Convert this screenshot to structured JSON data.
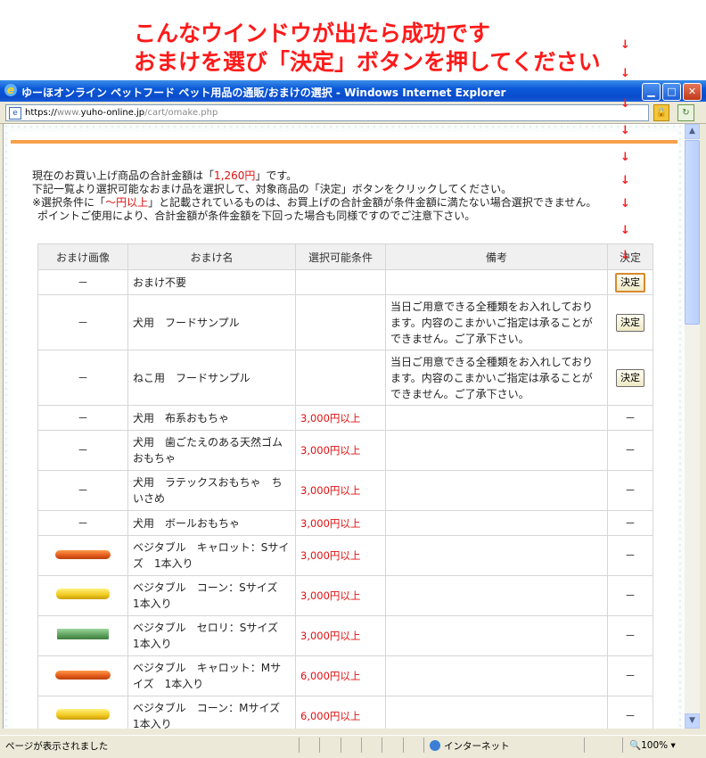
{
  "annotation": {
    "line1": "こんなウインドウが出たら成功です",
    "line2": "おまけを選び「決定」ボタンを押してください"
  },
  "window": {
    "title": "ゆーほオンライン ペットフード ペット用品の通販/おまけの選択 - Windows Internet Explorer",
    "address_prefix": "https://",
    "address_gray": "www.",
    "address_domain": "yuho-online.jp",
    "address_path": "/cart/omake.php"
  },
  "intro": {
    "line1_a": "現在のお買い上げ商品の合計金額は「",
    "line1_amount": "1,260円",
    "line1_b": "」です。",
    "line2": "下記一覧より選択可能なおまけ品を選択して、対象商品の「決定」ボタンをクリックしてください。",
    "line3_a": "※選択条件に「",
    "line3_red": "～円以上",
    "line3_b": "」と記載されているものは、お買上げの合計金額が条件金額に満たない場合選択できません。",
    "line4": "ポイントご使用により、合計金額が条件金額を下回った場合も同様ですのでご注意下さい。"
  },
  "table": {
    "headers": [
      "おまけ画像",
      "おまけ名",
      "選択可能条件",
      "備考",
      "決定"
    ],
    "kettei_label": "決定",
    "dash": "－",
    "rows": [
      {
        "image": "－",
        "name": "おまけ不要",
        "condition": "",
        "note": "",
        "action": "決定"
      },
      {
        "image": "－",
        "name": "犬用　フードサンプル",
        "condition": "",
        "note": "当日ご用意できる全種類をお入れしております。内容のこまかいご指定は承ることができません。ご了承下さい。",
        "action": "決定"
      },
      {
        "image": "－",
        "name": "ねこ用　フードサンプル",
        "condition": "",
        "note": "当日ご用意できる全種類をお入れしております。内容のこまかいご指定は承ることができません。ご了承下さい。",
        "action": "決定"
      },
      {
        "image": "－",
        "name": "犬用　布系おもちゃ",
        "condition": "3,000円以上",
        "note": "",
        "action": "－"
      },
      {
        "image": "－",
        "name": "犬用　歯ごたえのある天然ゴムおもちゃ",
        "condition": "3,000円以上",
        "note": "",
        "action": "－"
      },
      {
        "image": "－",
        "name": "犬用　ラテックスおもちゃ　ちいさめ",
        "condition": "3,000円以上",
        "note": "",
        "action": "－"
      },
      {
        "image": "－",
        "name": "犬用　ボールおもちゃ",
        "condition": "3,000円以上",
        "note": "",
        "action": "－"
      },
      {
        "image": "carrot",
        "name": "ベジタブル　キャロット：Sサイズ　1本入り",
        "condition": "3,000円以上",
        "note": "",
        "action": "－"
      },
      {
        "image": "corn",
        "name": "ベジタブル　コーン：Sサイズ　1本入り",
        "condition": "3,000円以上",
        "note": "",
        "action": "－"
      },
      {
        "image": "celery",
        "name": "ベジタブル　セロリ：Sサイズ　1本入り",
        "condition": "3,000円以上",
        "note": "",
        "action": "－"
      },
      {
        "image": "carrot",
        "name": "ベジタブル　キャロット：Mサイズ　1本入り",
        "condition": "6,000円以上",
        "note": "",
        "action": "－"
      },
      {
        "image": "corn",
        "name": "ベジタブル　コーン：Mサイズ　1本入り",
        "condition": "6,000円以上",
        "note": "",
        "action": "－"
      }
    ]
  },
  "status": {
    "text": "ページが表示されました",
    "zone": "インターネット",
    "zoom": "100%"
  },
  "colors": {
    "annotation_red": "#ff1a1a",
    "price_red": "#e01010",
    "accent_orange": "#f6a04a"
  }
}
